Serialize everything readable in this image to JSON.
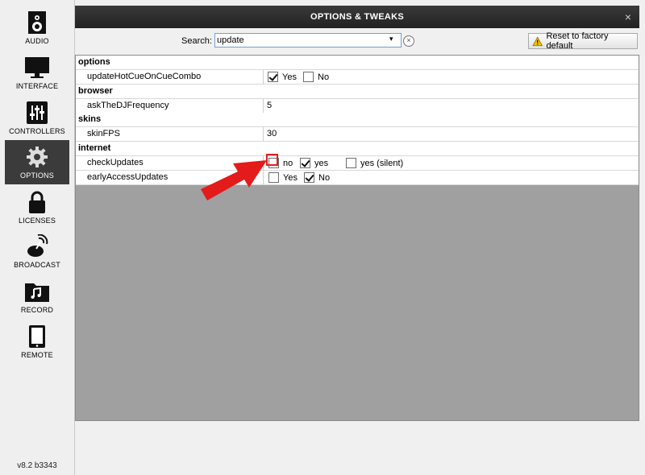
{
  "sidebar": {
    "items": [
      {
        "label": "AUDIO",
        "icon": "speaker-icon"
      },
      {
        "label": "INTERFACE",
        "icon": "monitor-icon"
      },
      {
        "label": "CONTROLLERS",
        "icon": "sliders-icon"
      },
      {
        "label": "OPTIONS",
        "icon": "gear-icon"
      },
      {
        "label": "LICENSES",
        "icon": "lock-icon"
      },
      {
        "label": "BROADCAST",
        "icon": "broadcast-icon"
      },
      {
        "label": "RECORD",
        "icon": "music-folder-icon"
      },
      {
        "label": "REMOTE",
        "icon": "tablet-icon"
      }
    ],
    "active": "OPTIONS",
    "version": "v8.2 b3343"
  },
  "window": {
    "title": "OPTIONS & TWEAKS",
    "close": "×"
  },
  "search": {
    "label": "Search:",
    "value": "update",
    "clear": "×"
  },
  "reset": {
    "label": "Reset to factory default",
    "icon": "warning-icon"
  },
  "sections": {
    "options": {
      "title": "options",
      "rows": [
        {
          "name": "updateHotCueOnCueCombo",
          "yes": "Yes",
          "no": "No",
          "yes_checked": true,
          "no_checked": false
        }
      ]
    },
    "browser": {
      "title": "browser",
      "rows": [
        {
          "name": "askTheDJFrequency",
          "value": "5"
        }
      ]
    },
    "skins": {
      "title": "skins",
      "rows": [
        {
          "name": "skinFPS",
          "value": "30"
        }
      ]
    },
    "internet": {
      "title": "internet",
      "check_updates": {
        "name": "checkUpdates",
        "no": "no",
        "yes": "yes",
        "silent": "yes (silent)",
        "checked": "yes"
      },
      "early_access": {
        "name": "earlyAccessUpdates",
        "yes": "Yes",
        "no": "No",
        "checked": "no"
      }
    }
  },
  "colors": {
    "accent_red": "#e31b1b",
    "active_nav": "#3b3b3b",
    "empty_area": "#a0a0a0"
  }
}
